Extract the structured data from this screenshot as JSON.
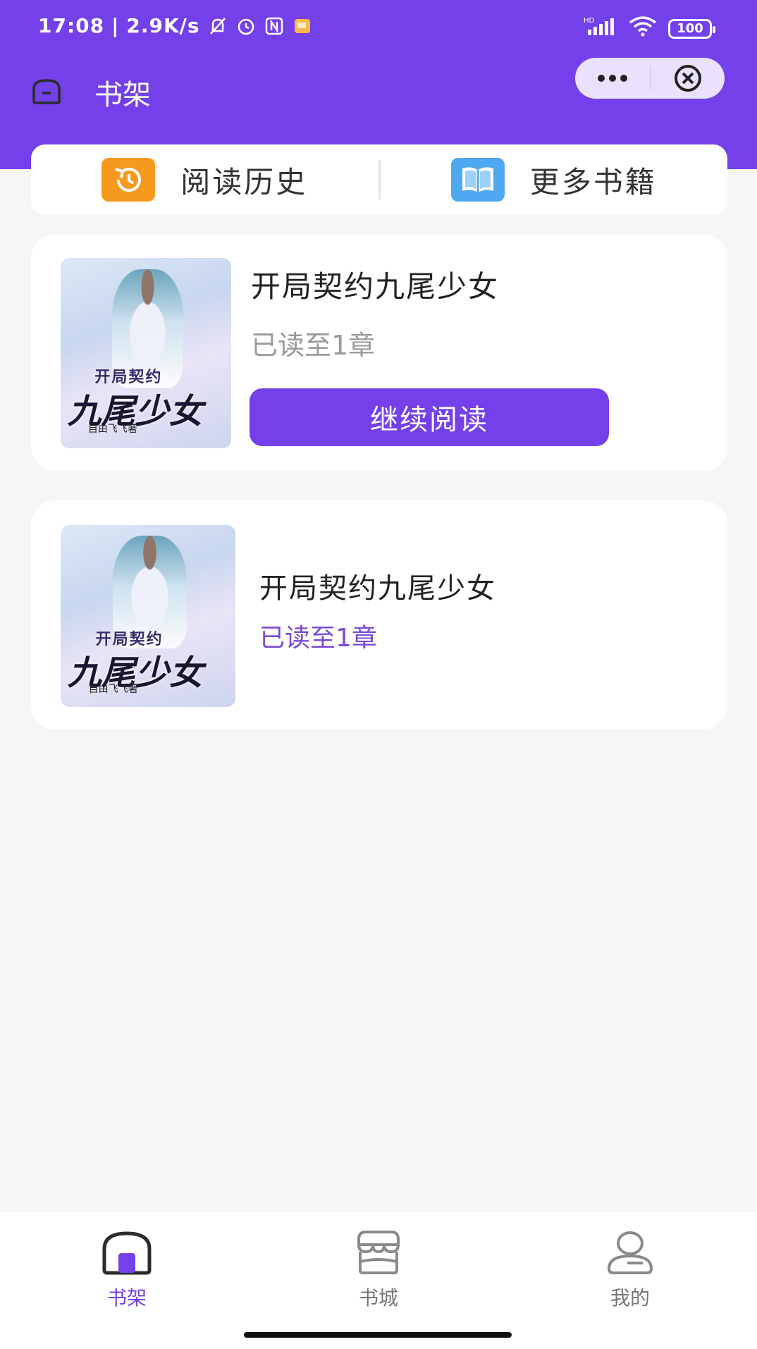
{
  "status_bar": {
    "time": "17:08",
    "speed": "2.9K/s",
    "battery": "100"
  },
  "nav": {
    "title": "书架"
  },
  "quick_bar": {
    "history_label": "阅读历史",
    "more_books_label": "更多书籍"
  },
  "books": [
    {
      "title": "开局契约九尾少女",
      "progress": "已读至1章",
      "continue_label": "继续阅读",
      "cover_title_small": "开局契约",
      "cover_title_big": "九尾少女",
      "cover_author": "自由飞飞著"
    },
    {
      "title": "开局契约九尾少女",
      "progress": "已读至1章",
      "cover_title_small": "开局契约",
      "cover_title_big": "九尾少女",
      "cover_author": "自由飞飞著"
    }
  ],
  "tabs": [
    {
      "label": "书架",
      "active": true
    },
    {
      "label": "书城",
      "active": false
    },
    {
      "label": "我的",
      "active": false
    }
  ],
  "colors": {
    "brand": "#7440ea",
    "progress_accent": "#7b4ad6",
    "history_icon": "#f59a1c",
    "more_books_icon": "#4fa9f2"
  }
}
